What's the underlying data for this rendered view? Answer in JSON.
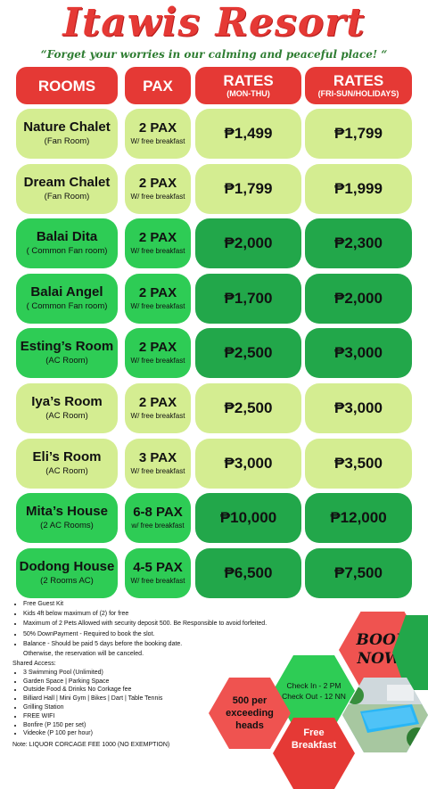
{
  "title": "Itawis Resort",
  "tagline": "“Forget your worries in our calming and peaceful place! “",
  "headers": {
    "rooms": "ROOMS",
    "pax": "PAX",
    "rates_weekday": "RATES",
    "rates_weekday_sub": "(MON-THU)",
    "rates_weekend": "RATES",
    "rates_weekend_sub": "(FRI-SUN/HOLIDAYS)"
  },
  "rooms": [
    {
      "name": "Nature Chalet",
      "sub": "(Fan Room)",
      "pax": "2 PAX",
      "pax_sub": "W/ free breakfast",
      "weekday": "₱1,499",
      "weekend": "₱1,799",
      "tone": "light"
    },
    {
      "name": "Dream Chalet",
      "sub": "(Fan Room)",
      "pax": "2 PAX",
      "pax_sub": "W/ free breakfast",
      "weekday": "₱1,799",
      "weekend": "₱1,999",
      "tone": "light"
    },
    {
      "name": "Balai Dita",
      "sub": "( Common Fan room)",
      "pax": "2 PAX",
      "pax_sub": "W/ free breakfast",
      "weekday": "₱2,000",
      "weekend": "₱2,300",
      "tone": "mid"
    },
    {
      "name": "Balai Angel",
      "sub": "( Common Fan room)",
      "pax": "2 PAX",
      "pax_sub": "W/ free breakfast",
      "weekday": "₱1,700",
      "weekend": "₱2,000",
      "tone": "mid"
    },
    {
      "name": "Esting’s Room",
      "sub": "(AC Room)",
      "pax": "2 PAX",
      "pax_sub": "W/ free breakfast",
      "weekday": "₱2,500",
      "weekend": "₱3,000",
      "tone": "mid"
    },
    {
      "name": "Iya’s Room",
      "sub": "(AC Room)",
      "pax": "2 PAX",
      "pax_sub": "W/ free breakfast",
      "weekday": "₱2,500",
      "weekend": "₱3,000",
      "tone": "light"
    },
    {
      "name": "Eli’s Room",
      "sub": "(AC Room)",
      "pax": "3 PAX",
      "pax_sub": "W/ free breakfast",
      "weekday": "₱3,000",
      "weekend": "₱3,500",
      "tone": "light"
    },
    {
      "name": "Mita’s House",
      "sub": "(2 AC Rooms)",
      "pax": "6-8 PAX",
      "pax_sub": "w/ free breakfast",
      "weekday": "₱10,000",
      "weekend": "₱12,000",
      "tone": "mid"
    },
    {
      "name": "Dodong House",
      "sub": "(2 Rooms AC)",
      "pax": "4-5 PAX",
      "pax_sub": "W/ free breakfast",
      "weekday": "₱6,500",
      "weekend": "₱7,500",
      "tone": "mid"
    }
  ],
  "notes": [
    "Free Guest Kit",
    "Kids 4ft below maximum of (2) for free",
    "Maximum of 2 Pets Allowed with security deposit 500. Be Responsible to avoid forfeited.",
    "50% DownPayment - Required to book the slot.",
    "Balance - Should be paid 5 days before the booking date."
  ],
  "notes_continuation": "Otherwise, the reservation will be canceled.",
  "shared_title": "Shared Access:",
  "shared": [
    "3 Swimming Pool (Unlimited)",
    "Garden Space | Parking Space",
    "Outside Food & Drinks No Corkage fee",
    "Billiard Hall | Mini Gym | Bikes | Dart | Table Tennis",
    "Grilling Station",
    "FREE WIFI",
    "Bonfire (P 150 per set)",
    "Videoke (P 100 per hour)"
  ],
  "footnote": "Note: LIQUOR CORCAGE FEE 1000 (NO EXEMPTION)",
  "promo": {
    "book_now": "BOOK NOW!",
    "check_in": "Check In - 2 PM",
    "check_out": "Check Out - 12 NN",
    "exceeding": "500 per exceeding heads",
    "free_breakfast": "Free Breakfast"
  },
  "colors": {
    "title_red": "#e53935",
    "light_green": "#d4ed91",
    "mid_green": "#2ecc55",
    "dark_green": "#22a74a"
  }
}
